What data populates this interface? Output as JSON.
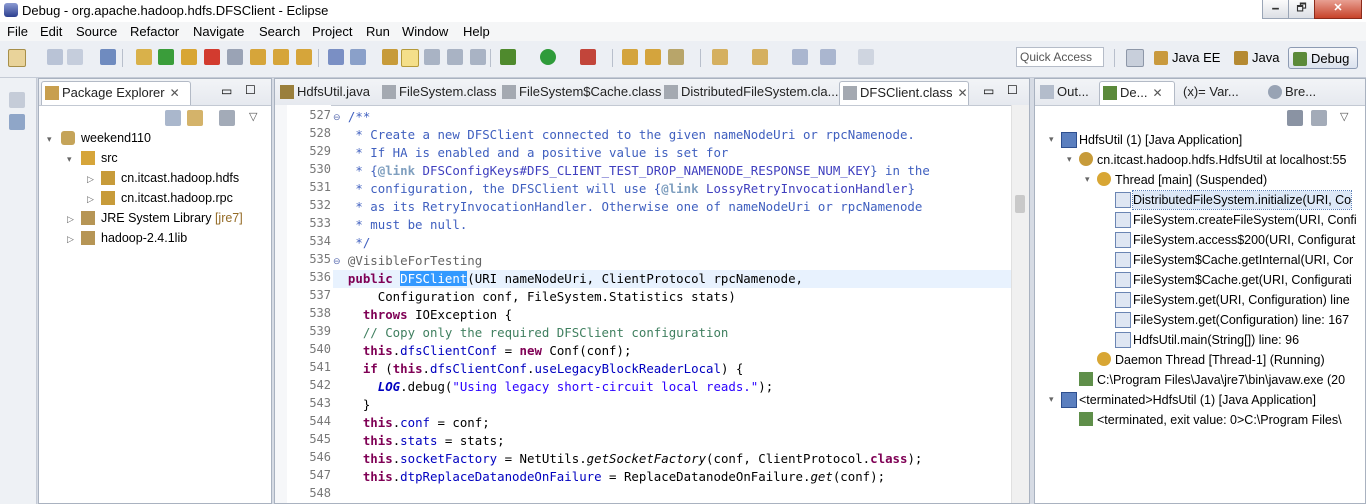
{
  "window": {
    "title": "Debug - org.apache.hadoop.hdfs.DFSClient - Eclipse",
    "min": "🗕",
    "max": "🗗",
    "close": "✕"
  },
  "menu": [
    "File",
    "Edit",
    "Source",
    "Refactor",
    "Navigate",
    "Search",
    "Project",
    "Run",
    "Window",
    "Help"
  ],
  "toolbar": {
    "quick_access_placeholder": "Quick Access",
    "perspectives": [
      "Java EE",
      "Java",
      "Debug"
    ],
    "colors": {
      "accent": "#3399ff",
      "bg": "#d6dbe4"
    }
  },
  "package_explorer": {
    "tab": "Package Explorer",
    "tree": [
      {
        "label": "weekend110",
        "depth": 0,
        "expanded": true
      },
      {
        "label": "src",
        "depth": 1,
        "expanded": true
      },
      {
        "label": "cn.itcast.hadoop.hdfs",
        "depth": 2,
        "expanded": false
      },
      {
        "label": "cn.itcast.hadoop.rpc",
        "depth": 2,
        "expanded": false
      },
      {
        "label": "JRE System Library",
        "suffix": "[jre7]",
        "depth": 1,
        "expanded": false
      },
      {
        "label": "hadoop-2.4.1lib",
        "depth": 1,
        "expanded": false
      }
    ]
  },
  "editor": {
    "tabs": [
      "HdfsUtil.java",
      "FileSystem.class",
      "FileSystem$Cache.class",
      "DistributedFileSystem.cla...",
      "DFSClient.class"
    ],
    "active_tab": 4,
    "first_line": 527,
    "line_numbers": [
      "527",
      "528",
      "529",
      "530",
      "531",
      "532",
      "533",
      "534",
      "535",
      "536",
      "537",
      "538",
      "539",
      "540",
      "541",
      "542",
      "543",
      "544",
      "545",
      "546",
      "547",
      "548"
    ],
    "code": [
      {
        "t": "/**",
        "kind": "cm",
        "indent": "  "
      },
      {
        "t": " * Create a new DFSClient connected to the given nameNodeUri or rpcNamenode.",
        "kind": "cm",
        "indent": "  "
      },
      {
        "t": " * If HA is enabled and a positive value is set for",
        "kind": "cm",
        "indent": "  "
      },
      {
        "t": " * {@link DFSConfigKeys#DFS_CLIENT_TEST_DROP_NAMENODE_RESPONSE_NUM_KEY} in the",
        "kind": "cm",
        "indent": "  "
      },
      {
        "t": " * configuration, the DFSClient will use {@link LossyRetryInvocationHandler}",
        "kind": "cm",
        "indent": "  "
      },
      {
        "t": " * as its RetryInvocationHandler. Otherwise one of nameNodeUri or rpcNamenode",
        "kind": "cm",
        "indent": "  "
      },
      {
        "t": " * must be null.",
        "kind": "cm",
        "indent": "  "
      },
      {
        "t": " */",
        "kind": "cm",
        "indent": "  "
      },
      {
        "t": "@VisibleForTesting",
        "kind": "ann",
        "indent": "  "
      },
      {
        "t": "public DFSClient(URI nameNodeUri, ClientProtocol rpcNamenode,",
        "kind": "sig",
        "indent": "  "
      },
      {
        "t": "Configuration conf, FileSystem.Statistics stats)",
        "kind": "plain",
        "indent": "      "
      },
      {
        "t": "throws IOException {",
        "kind": "throws",
        "indent": "    "
      },
      {
        "t": "// Copy only the required DFSClient configuration",
        "kind": "sl",
        "indent": "    "
      },
      {
        "t": "this.dfsClientConf = new Conf(conf);",
        "kind": "mix1",
        "indent": "    "
      },
      {
        "t": "if (this.dfsClientConf.useLegacyBlockReaderLocal) {",
        "kind": "mix2",
        "indent": "    "
      },
      {
        "t": "LOG.debug(\"Using legacy short-circuit local reads.\");",
        "kind": "mix3",
        "indent": "      "
      },
      {
        "t": "}",
        "kind": "plain",
        "indent": "    "
      },
      {
        "t": "this.conf = conf;",
        "kind": "mix4",
        "indent": "    "
      },
      {
        "t": "this.stats = stats;",
        "kind": "mix5",
        "indent": "    "
      },
      {
        "t": "this.socketFactory = NetUtils.getSocketFactory(conf, ClientProtocol.class);",
        "kind": "mix6",
        "indent": "    "
      },
      {
        "t": "this.dtpReplaceDatanodeOnFailure = ReplaceDatanodeOnFailure.get(conf);",
        "kind": "mix7",
        "indent": "    "
      },
      {
        "t": "",
        "kind": "plain",
        "indent": ""
      }
    ]
  },
  "debug_view": {
    "tabs": [
      "Out...",
      "De...",
      "(x)= Var...",
      "Bre..."
    ],
    "tree": [
      {
        "label": "HdfsUtil (1) [Java Application]",
        "depth": 0,
        "icon": "app"
      },
      {
        "label": "cn.itcast.hadoop.hdfs.HdfsUtil at localhost:55",
        "depth": 1,
        "icon": "vm"
      },
      {
        "label": "Thread [main] (Suspended)",
        "depth": 2,
        "icon": "thread"
      },
      {
        "label": "DistributedFileSystem.initialize(URI, Co",
        "depth": 3,
        "icon": "frame",
        "selected": true
      },
      {
        "label": "FileSystem.createFileSystem(URI, Confi",
        "depth": 3,
        "icon": "frame"
      },
      {
        "label": "FileSystem.access$200(URI, Configurat",
        "depth": 3,
        "icon": "frame"
      },
      {
        "label": "FileSystem$Cache.getInternal(URI, Cor",
        "depth": 3,
        "icon": "frame"
      },
      {
        "label": "FileSystem$Cache.get(URI, Configurati",
        "depth": 3,
        "icon": "frame"
      },
      {
        "label": "FileSystem.get(URI, Configuration) line",
        "depth": 3,
        "icon": "frame"
      },
      {
        "label": "FileSystem.get(Configuration) line: 167",
        "depth": 3,
        "icon": "frame"
      },
      {
        "label": "HdfsUtil.main(String[]) line: 96",
        "depth": 3,
        "icon": "frame"
      },
      {
        "label": "Daemon Thread [Thread-1] (Running)",
        "depth": 2,
        "icon": "thread"
      },
      {
        "label": "C:\\Program Files\\Java\\jre7\\bin\\javaw.exe (20",
        "depth": 1,
        "icon": "proc"
      },
      {
        "label": "<terminated>HdfsUtil (1) [Java Application]",
        "depth": 0,
        "icon": "app"
      },
      {
        "label": "<terminated, exit value: 0>C:\\Program Files\\",
        "depth": 1,
        "icon": "proc"
      }
    ]
  }
}
